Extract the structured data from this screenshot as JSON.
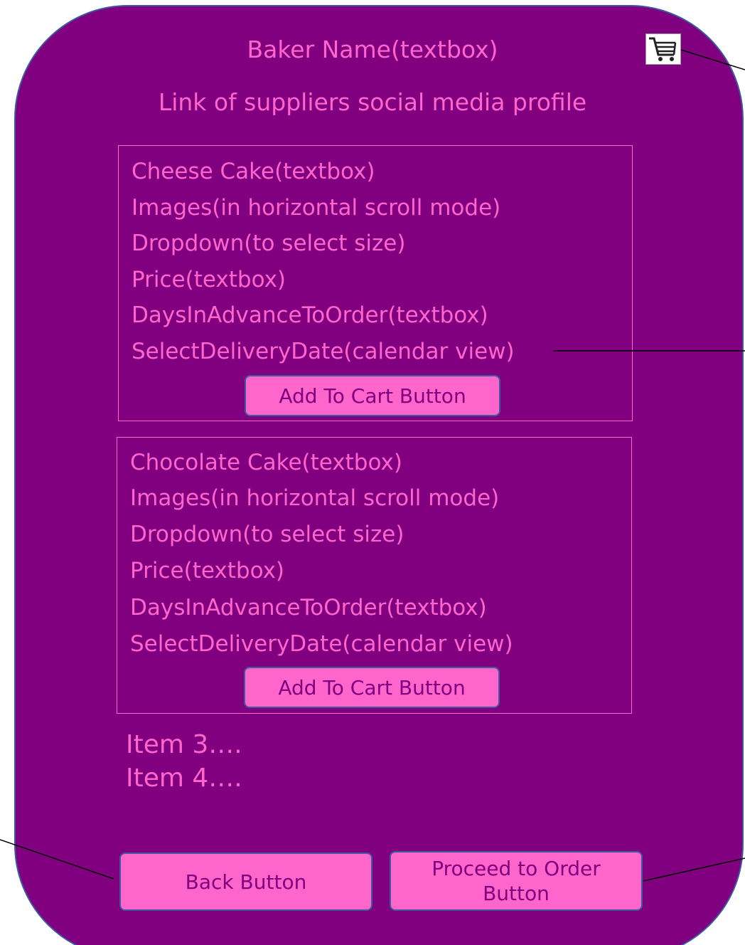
{
  "header": {
    "baker_name": "Baker Name(textbox)",
    "social_link": "Link of suppliers social media profile",
    "cart_icon": "shopping-cart-icon"
  },
  "products": [
    {
      "name": "Cheese Cake(textbox)",
      "images": "Images(in horizontal scroll mode)",
      "dropdown": "Dropdown(to select size)",
      "price": "Price(textbox)",
      "days_advance": "DaysInAdvanceToOrder(textbox)",
      "delivery_date": "SelectDeliveryDate(calendar view)",
      "add_button": "Add To Cart Button"
    },
    {
      "name": "Chocolate Cake(textbox)",
      "images": "Images(in horizontal scroll mode)",
      "dropdown": "Dropdown(to select size)",
      "price": "Price(textbox)",
      "days_advance": "DaysInAdvanceToOrder(textbox)",
      "delivery_date": "SelectDeliveryDate(calendar view)",
      "add_button": "Add To Cart Button"
    }
  ],
  "more_items": [
    "Item 3….",
    "Item 4…."
  ],
  "footer": {
    "back_button": "Back Button",
    "proceed_button_line1": "Proceed to Order",
    "proceed_button_line2": "Button"
  },
  "colors": {
    "background": "#800080",
    "accent": "#ff66cc",
    "border": "#3d5a9e"
  }
}
